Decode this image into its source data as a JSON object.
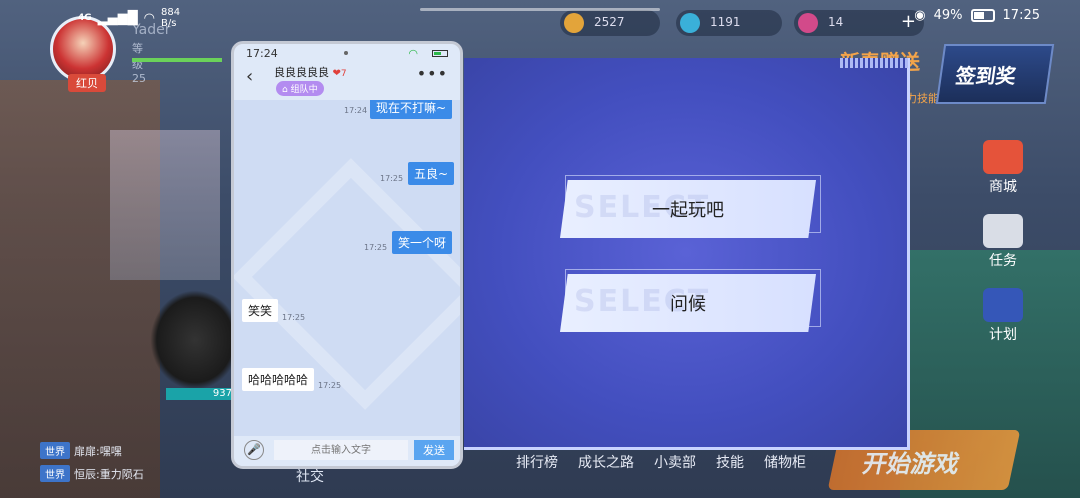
{
  "status_bar": {
    "network": "4G",
    "speed_value": "884",
    "speed_unit": "B/s",
    "battery": "49%",
    "time": "17:25"
  },
  "resources": [
    {
      "value": "2527",
      "color": "#e3a43a"
    },
    {
      "value": "1191",
      "color": "#3ab0d9"
    },
    {
      "value": "14",
      "color": "#d24a8a"
    }
  ],
  "profile": {
    "name": "Yader",
    "level_label": "等级",
    "level_value": "25",
    "tag": "红贝"
  },
  "banners": {
    "newbie_title": "新春赠送",
    "newbie_sub": "永久跃和、强力技能",
    "signin": "签到奖"
  },
  "chat_log": [
    {
      "channel": "世界",
      "text": "扉扉:嘿嘿"
    },
    {
      "channel": "世界",
      "text": "恒辰:重力陨石"
    }
  ],
  "right_menu": [
    {
      "label": "商城",
      "icon": "shop-cart-icon"
    },
    {
      "label": "任务",
      "icon": "task-list-icon"
    },
    {
      "label": "计划",
      "icon": "plan-badge-icon"
    }
  ],
  "bottom_menu": [
    "排行榜",
    "成长之路",
    "小卖部",
    "技能",
    "储物柜"
  ],
  "bottom_left_label": "社交",
  "start_button": "开始游戏",
  "kart_number": "937",
  "dialog": {
    "watermark": "SELECT",
    "options": [
      "一起玩吧",
      "问候"
    ]
  },
  "phone": {
    "time": "17:24",
    "contact_name": "良良良良良",
    "heart_count": "7",
    "group_status": "组队中",
    "messages": [
      {
        "direction": "out",
        "text": "现在不打嘛~",
        "time": "17:24"
      },
      {
        "direction": "out",
        "text": "五良~",
        "time": "17:25"
      },
      {
        "direction": "out",
        "text": "笑一个呀",
        "time": "17:25"
      },
      {
        "direction": "in",
        "text": "笑笑",
        "time": "17:25"
      },
      {
        "direction": "in",
        "text": "哈哈哈哈哈",
        "time": "17:25"
      }
    ],
    "input_placeholder": "点击输入文字",
    "send_label": "发送"
  }
}
